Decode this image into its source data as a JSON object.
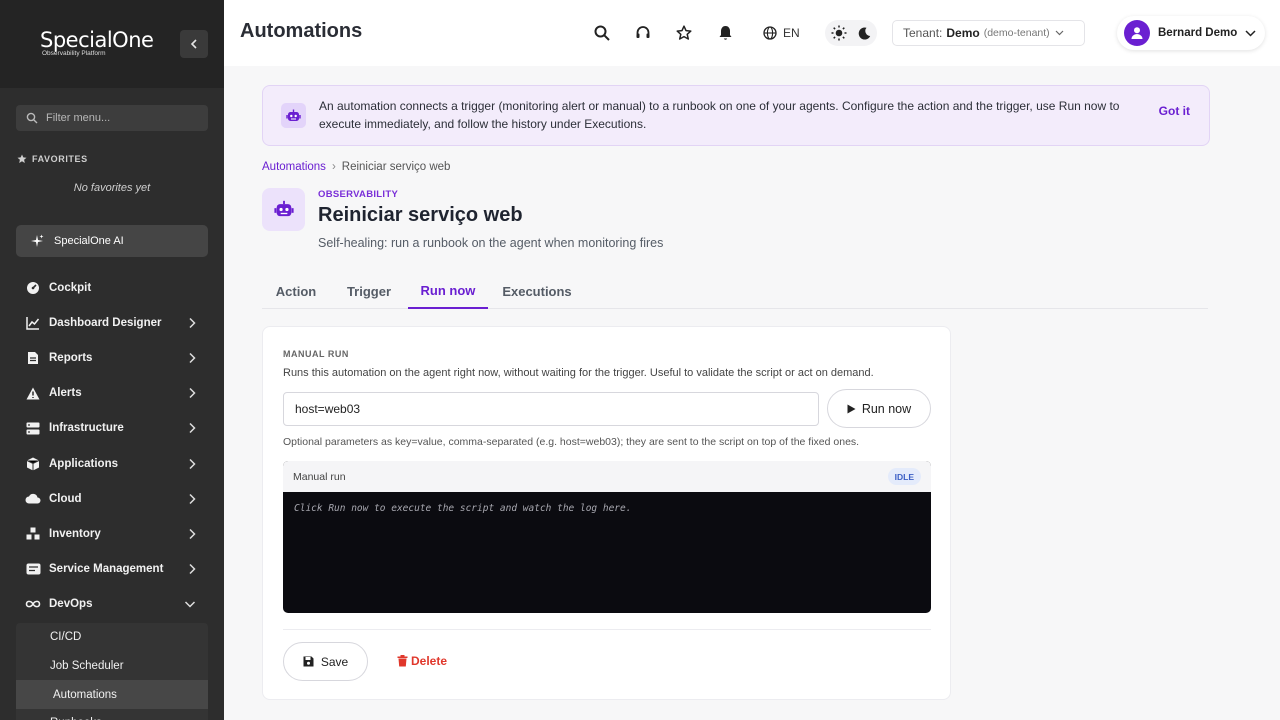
{
  "sidebar": {
    "logo_name": "SpecialOne",
    "logo_sub": "Observability Platform",
    "filter_placeholder": "Filter menu...",
    "favorites_heading": "FAVORITES",
    "favorites_empty": "No favorites yet",
    "ai_label": "SpecialOne AI",
    "items": [
      {
        "label": "Cockpit",
        "icon": "gauge-icon"
      },
      {
        "label": "Dashboard Designer",
        "icon": "chart-line-icon"
      },
      {
        "label": "Reports",
        "icon": "document-icon"
      },
      {
        "label": "Alerts",
        "icon": "warning-icon"
      },
      {
        "label": "Infrastructure",
        "icon": "server-icon"
      },
      {
        "label": "Applications",
        "icon": "cube-icon"
      },
      {
        "label": "Cloud",
        "icon": "cloud-icon"
      },
      {
        "label": "Inventory",
        "icon": "boxes-icon"
      },
      {
        "label": "Service Management",
        "icon": "service-icon"
      },
      {
        "label": "DevOps",
        "icon": "infinity-icon"
      }
    ],
    "devops_children": [
      "CI/CD",
      "Job Scheduler",
      "Automations",
      "Runbooks"
    ]
  },
  "header": {
    "title": "Automations",
    "language": "EN",
    "tenant_label": "Tenant:",
    "tenant_name": "Demo",
    "tenant_id": "(demo-tenant)",
    "user_name": "Bernard Demo"
  },
  "banner": {
    "text": "An automation connects a trigger (monitoring alert or manual) to a runbook on one of your agents. Configure the action and the trigger, use Run now to execute immediately, and follow the history under Executions.",
    "dismiss": "Got it"
  },
  "breadcrumb": {
    "root": "Automations",
    "current": "Reiniciar serviço web"
  },
  "record": {
    "category": "OBSERVABILITY",
    "title": "Reiniciar serviço web",
    "subtitle": "Self-healing: run a runbook on the agent when monitoring fires"
  },
  "tabs": [
    "Action",
    "Trigger",
    "Run now",
    "Executions"
  ],
  "active_tab": "Run now",
  "manual_run": {
    "section_label": "MANUAL RUN",
    "description": "Runs this automation on the agent right now, without waiting for the trigger. Useful to validate the script or act on demand.",
    "params_value": "host=web03",
    "run_button": "Run now",
    "hint": "Optional parameters as key=value, comma-separated (e.g. host=web03); they are sent to the script on top of the fixed ones.",
    "console_title": "Manual run",
    "status": "IDLE",
    "console_placeholder": "Click Run now to execute the script and watch the log here."
  },
  "actions": {
    "save": "Save",
    "delete": "Delete"
  },
  "colors": {
    "accent": "#6a1fd1",
    "danger": "#e0372b",
    "sidebar_bg": "#2d2d2d"
  }
}
